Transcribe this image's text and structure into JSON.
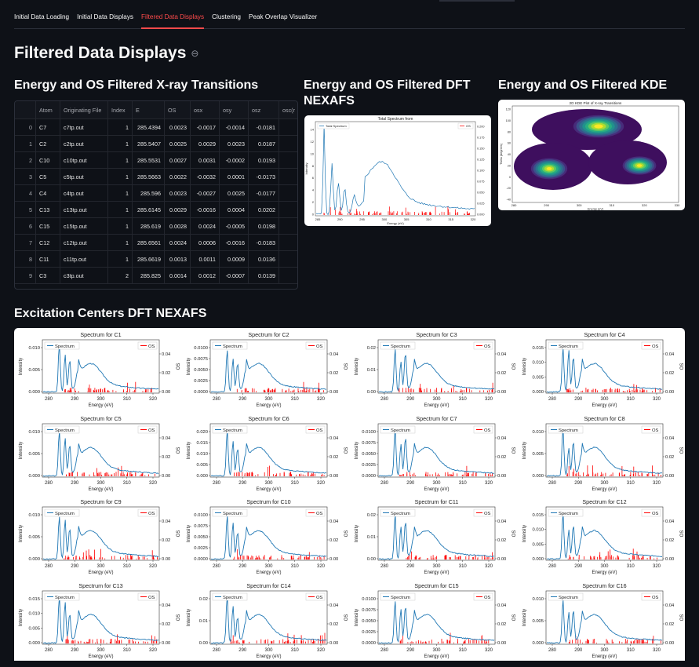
{
  "tabs": [
    {
      "label": "Initial Data Loading",
      "active": false
    },
    {
      "label": "Initial Data Displays",
      "active": false
    },
    {
      "label": "Filtered Data Displays",
      "active": true
    },
    {
      "label": "Clustering",
      "active": false
    },
    {
      "label": "Peak Overlap Visualizer",
      "active": false
    }
  ],
  "page_title": "Filtered Data Displays",
  "section_table_title": "Energy and OS Filtered X-ray Transitions",
  "section_dft_title": "Energy and OS Filtered DFT NEXAFS",
  "section_kde_title": "Energy and OS Filtered KDE",
  "section_centers_title": "Excitation Centers DFT NEXAFS",
  "table": {
    "columns": [
      "",
      "Atom",
      "Originating File",
      "Index",
      "E",
      "OS",
      "osx",
      "osy",
      "osz",
      "osc(r"
    ],
    "rows": [
      [
        "0",
        "C7",
        "c7tp.out",
        "1",
        "285.4394",
        "0.0023",
        "-0.0017",
        "-0.0014",
        "-0.0181",
        ""
      ],
      [
        "1",
        "C2",
        "c2tp.out",
        "1",
        "285.5407",
        "0.0025",
        "0.0029",
        "0.0023",
        "0.0187",
        ""
      ],
      [
        "2",
        "C10",
        "c10tp.out",
        "1",
        "285.5531",
        "0.0027",
        "0.0031",
        "-0.0002",
        "0.0193",
        ""
      ],
      [
        "3",
        "C5",
        "c5tp.out",
        "1",
        "285.5663",
        "0.0022",
        "-0.0032",
        "0.0001",
        "-0.0173",
        ""
      ],
      [
        "4",
        "C4",
        "c4tp.out",
        "1",
        "285.596",
        "0.0023",
        "-0.0027",
        "0.0025",
        "-0.0177",
        ""
      ],
      [
        "5",
        "C13",
        "c13tp.out",
        "1",
        "285.6145",
        "0.0029",
        "-0.0016",
        "0.0004",
        "0.0202",
        ""
      ],
      [
        "6",
        "C15",
        "c15tp.out",
        "1",
        "285.619",
        "0.0028",
        "0.0024",
        "-0.0005",
        "0.0198",
        ""
      ],
      [
        "7",
        "C12",
        "c12tp.out",
        "1",
        "285.6561",
        "0.0024",
        "0.0006",
        "-0.0016",
        "-0.0183",
        ""
      ],
      [
        "8",
        "C11",
        "c11tp.out",
        "1",
        "285.6619",
        "0.0013",
        "0.0011",
        "0.0009",
        "0.0136",
        ""
      ],
      [
        "9",
        "C3",
        "c3tp.out",
        "2",
        "285.825",
        "0.0014",
        "0.0012",
        "-0.0007",
        "0.0139",
        ""
      ]
    ]
  },
  "dft_chart": {
    "title": "Total Spectrum from",
    "legend_spectrum": "Total Spectrum",
    "legend_os": "OS",
    "xlabel": "Energy (eV)",
    "ylabel": "Intensity",
    "y2label": "OS",
    "x_ticks": [
      "285",
      "290",
      "295",
      "300",
      "305",
      "310",
      "315",
      "320"
    ],
    "y_ticks": [
      "0",
      "2",
      "4",
      "6",
      "8",
      "10",
      "12",
      "14"
    ],
    "y2_ticks": [
      "0.000",
      "0.025",
      "0.050",
      "0.075",
      "0.100",
      "0.125",
      "0.150",
      "0.175",
      "0.200"
    ]
  },
  "kde_chart": {
    "title": "2D KDE Plot of X-ray Transitions",
    "xlabel": "Energy (eV)",
    "ylabel": "Theta (degrees)",
    "x_ticks": [
      "280",
      "290",
      "300",
      "310",
      "320",
      "330"
    ],
    "y_ticks": [
      "120",
      "100",
      "80",
      "60",
      "40",
      "20",
      "0",
      "-20",
      "-40"
    ]
  },
  "small_charts": {
    "legend_spectrum": "Spectrum",
    "legend_os": "OS",
    "xlabel": "Energy (eV)",
    "ylabel": "Intensity",
    "y2label": "OS",
    "x_ticks": [
      "280",
      "290",
      "300",
      "310",
      "320"
    ],
    "y2_ticks": [
      "0.00",
      "0.02",
      "0.04"
    ],
    "panels": [
      {
        "title": "Spectrum for C1",
        "y_ticks": [
          "0.000",
          "0.005",
          "0.010"
        ]
      },
      {
        "title": "Spectrum for C2",
        "y_ticks": [
          "0.0000",
          "0.0025",
          "0.0050",
          "0.0075",
          "0.0100"
        ]
      },
      {
        "title": "Spectrum for C3",
        "y_ticks": [
          "0.00",
          "0.01",
          "0.02"
        ]
      },
      {
        "title": "Spectrum for C4",
        "y_ticks": [
          "0.000",
          "0.005",
          "0.010",
          "0.015"
        ]
      },
      {
        "title": "Spectrum for C5",
        "y_ticks": [
          "0.000",
          "0.005",
          "0.010"
        ]
      },
      {
        "title": "Spectrum for C6",
        "y_ticks": [
          "0.000",
          "0.005",
          "0.010",
          "0.015",
          "0.020"
        ]
      },
      {
        "title": "Spectrum for C7",
        "y_ticks": [
          "0.0000",
          "0.0025",
          "0.0050",
          "0.0075",
          "0.0100"
        ]
      },
      {
        "title": "Spectrum for C8",
        "y_ticks": [
          "0.000",
          "0.005",
          "0.010"
        ]
      },
      {
        "title": "Spectrum for C9",
        "y_ticks": [
          "0.000",
          "0.005",
          "0.010"
        ]
      },
      {
        "title": "Spectrum for C10",
        "y_ticks": [
          "0.0000",
          "0.0025",
          "0.0050",
          "0.0075",
          "0.0100"
        ]
      },
      {
        "title": "Spectrum for C11",
        "y_ticks": [
          "0.00",
          "0.01",
          "0.02"
        ]
      },
      {
        "title": "Spectrum for C12",
        "y_ticks": [
          "0.000",
          "0.005",
          "0.010",
          "0.015"
        ]
      },
      {
        "title": "Spectrum for C13",
        "y_ticks": [
          "0.000",
          "0.005",
          "0.010",
          "0.015"
        ]
      },
      {
        "title": "Spectrum for C14",
        "y_ticks": [
          "0.00",
          "0.01",
          "0.02"
        ]
      },
      {
        "title": "Spectrum for C15",
        "y_ticks": [
          "0.0000",
          "0.0025",
          "0.0050",
          "0.0075",
          "0.0100"
        ]
      },
      {
        "title": "Spectrum for C16",
        "y_ticks": [
          "0.000",
          "0.005",
          "0.010"
        ]
      }
    ]
  },
  "colors": {
    "accent": "#ff4b4b",
    "spectrum": "#1f77b4",
    "os": "#ff0000",
    "bg": "#0e1117"
  }
}
